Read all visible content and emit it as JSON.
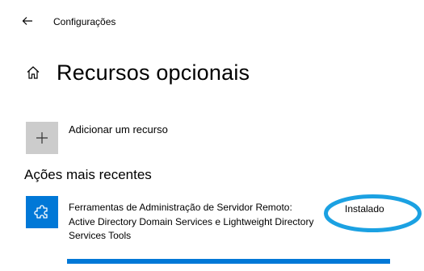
{
  "window": {
    "title": "Configurações"
  },
  "page": {
    "title": "Recursos opcionais"
  },
  "add_feature": {
    "label": "Adicionar um recurso"
  },
  "recent_actions": {
    "heading": "Ações mais recentes",
    "items": [
      {
        "name": "Ferramentas de Administração de Servidor Remoto:",
        "detail": "Active Directory Domain Services e Lightweight Directory Services Tools",
        "status": "Instalado",
        "progress_percent": 100,
        "icon": "puzzle-icon"
      }
    ]
  },
  "annotation": {
    "color": "#1ba1e2"
  },
  "colors": {
    "accent": "#0078d7",
    "tile_gray": "#cccccc"
  }
}
